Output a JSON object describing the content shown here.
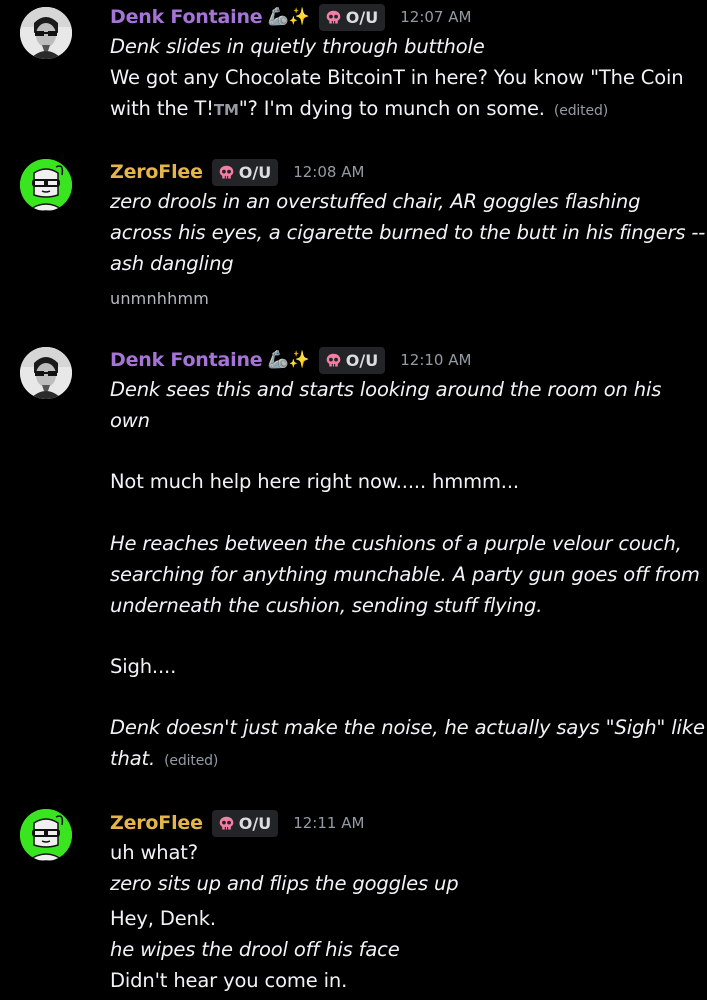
{
  "messages": [
    {
      "username": "Denk Fontaine",
      "emoji": "🦾✨",
      "tag": "O/U",
      "timestamp": "12:07 AM",
      "lines": [
        "Denk slides in quietly through butthole",
        "We got any Chocolate BitcoinT in here? You know \"The Coin",
        "with the T!",
        "TM",
        "\"? I'm dying to munch on some.",
        "(edited)"
      ]
    },
    {
      "username": "ZeroFlee",
      "tag": "O/U",
      "timestamp": "12:08 AM",
      "lines": [
        "zero drools in an overstuffed chair, AR goggles flashing",
        "across his eyes, a cigarette burned to the butt in his fingers --",
        "ash dangling",
        "unmnhhmm"
      ]
    },
    {
      "username": "Denk Fontaine",
      "emoji": "🦾✨",
      "tag": "O/U",
      "timestamp": "12:10 AM",
      "lines": [
        "Denk sees this and starts looking around the room on his",
        "own",
        "Not much help here right now..... hmmm...",
        "He reaches between the cushions of a purple velour couch,",
        "searching for anything munchable. A party gun goes off from",
        "underneath the cushion, sending stuff flying.",
        "Sigh....",
        "Denk doesn't just make the noise, he actually says \"Sigh\" like",
        "that.",
        "(edited)"
      ]
    },
    {
      "username": "ZeroFlee",
      "tag": "O/U",
      "timestamp": "12:11 AM",
      "lines": [
        "uh what?",
        "zero sits up and flips the goggles up",
        "Hey, Denk.",
        "he wipes the drool off his face",
        "Didn't hear you come in."
      ]
    }
  ],
  "colors": {
    "background": "#000000",
    "denk_name": "#a674d6",
    "zero_name": "#e4b54a",
    "text": "#f2f3f5",
    "muted": "#949ba4",
    "tag_bg": "#232428",
    "tag_skull": "#f47fa4",
    "zero_avatar_bg": "#39e51f"
  }
}
